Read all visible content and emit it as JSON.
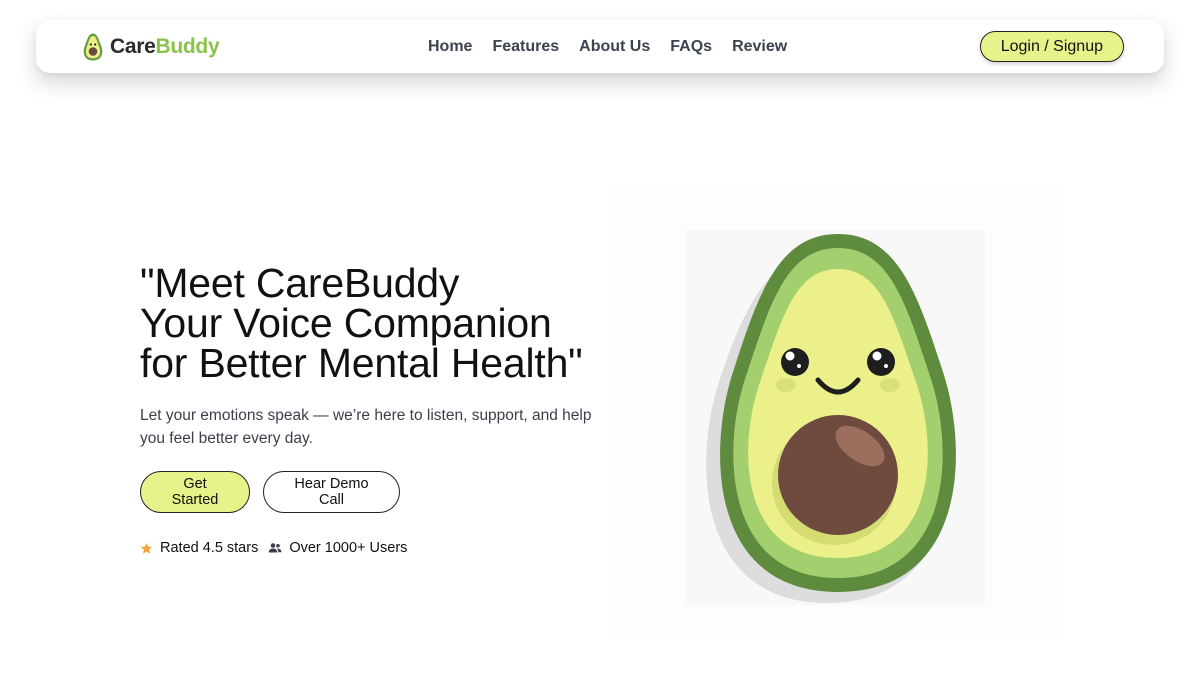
{
  "brand": {
    "name_part1": "Care",
    "name_part2": "Buddy",
    "logo_icon": "avocado-logo-icon"
  },
  "nav": {
    "links": [
      "Home",
      "Features",
      "About Us",
      "FAQs",
      "Review"
    ],
    "login_label": "Login / Signup"
  },
  "hero": {
    "title_lines": [
      "\"Meet CareBuddy",
      "Your Voice Companion",
      "for Better Mental Health\""
    ],
    "subtitle": "Let your emotions speak — we’re here to listen, support, and help you feel better every day.",
    "primary_cta": "Get Started",
    "secondary_cta": "Hear Demo Call",
    "rating_text": "Rated 4.5 stars",
    "rating_icon": "star-icon",
    "users_text": "Over 1000+ Users",
    "users_icon": "users-icon"
  },
  "illustration": {
    "icon": "avocado-mascot-illustration"
  },
  "colors": {
    "accent": "#e8f28b",
    "brand_green": "#8bc34a",
    "avocado_dark_green": "#5e8b3e",
    "avocado_light_green": "#a4cf6e",
    "avocado_flesh": "#ebf08a",
    "pit_brown": "#6e4b3e",
    "star": "#f2a33a"
  }
}
